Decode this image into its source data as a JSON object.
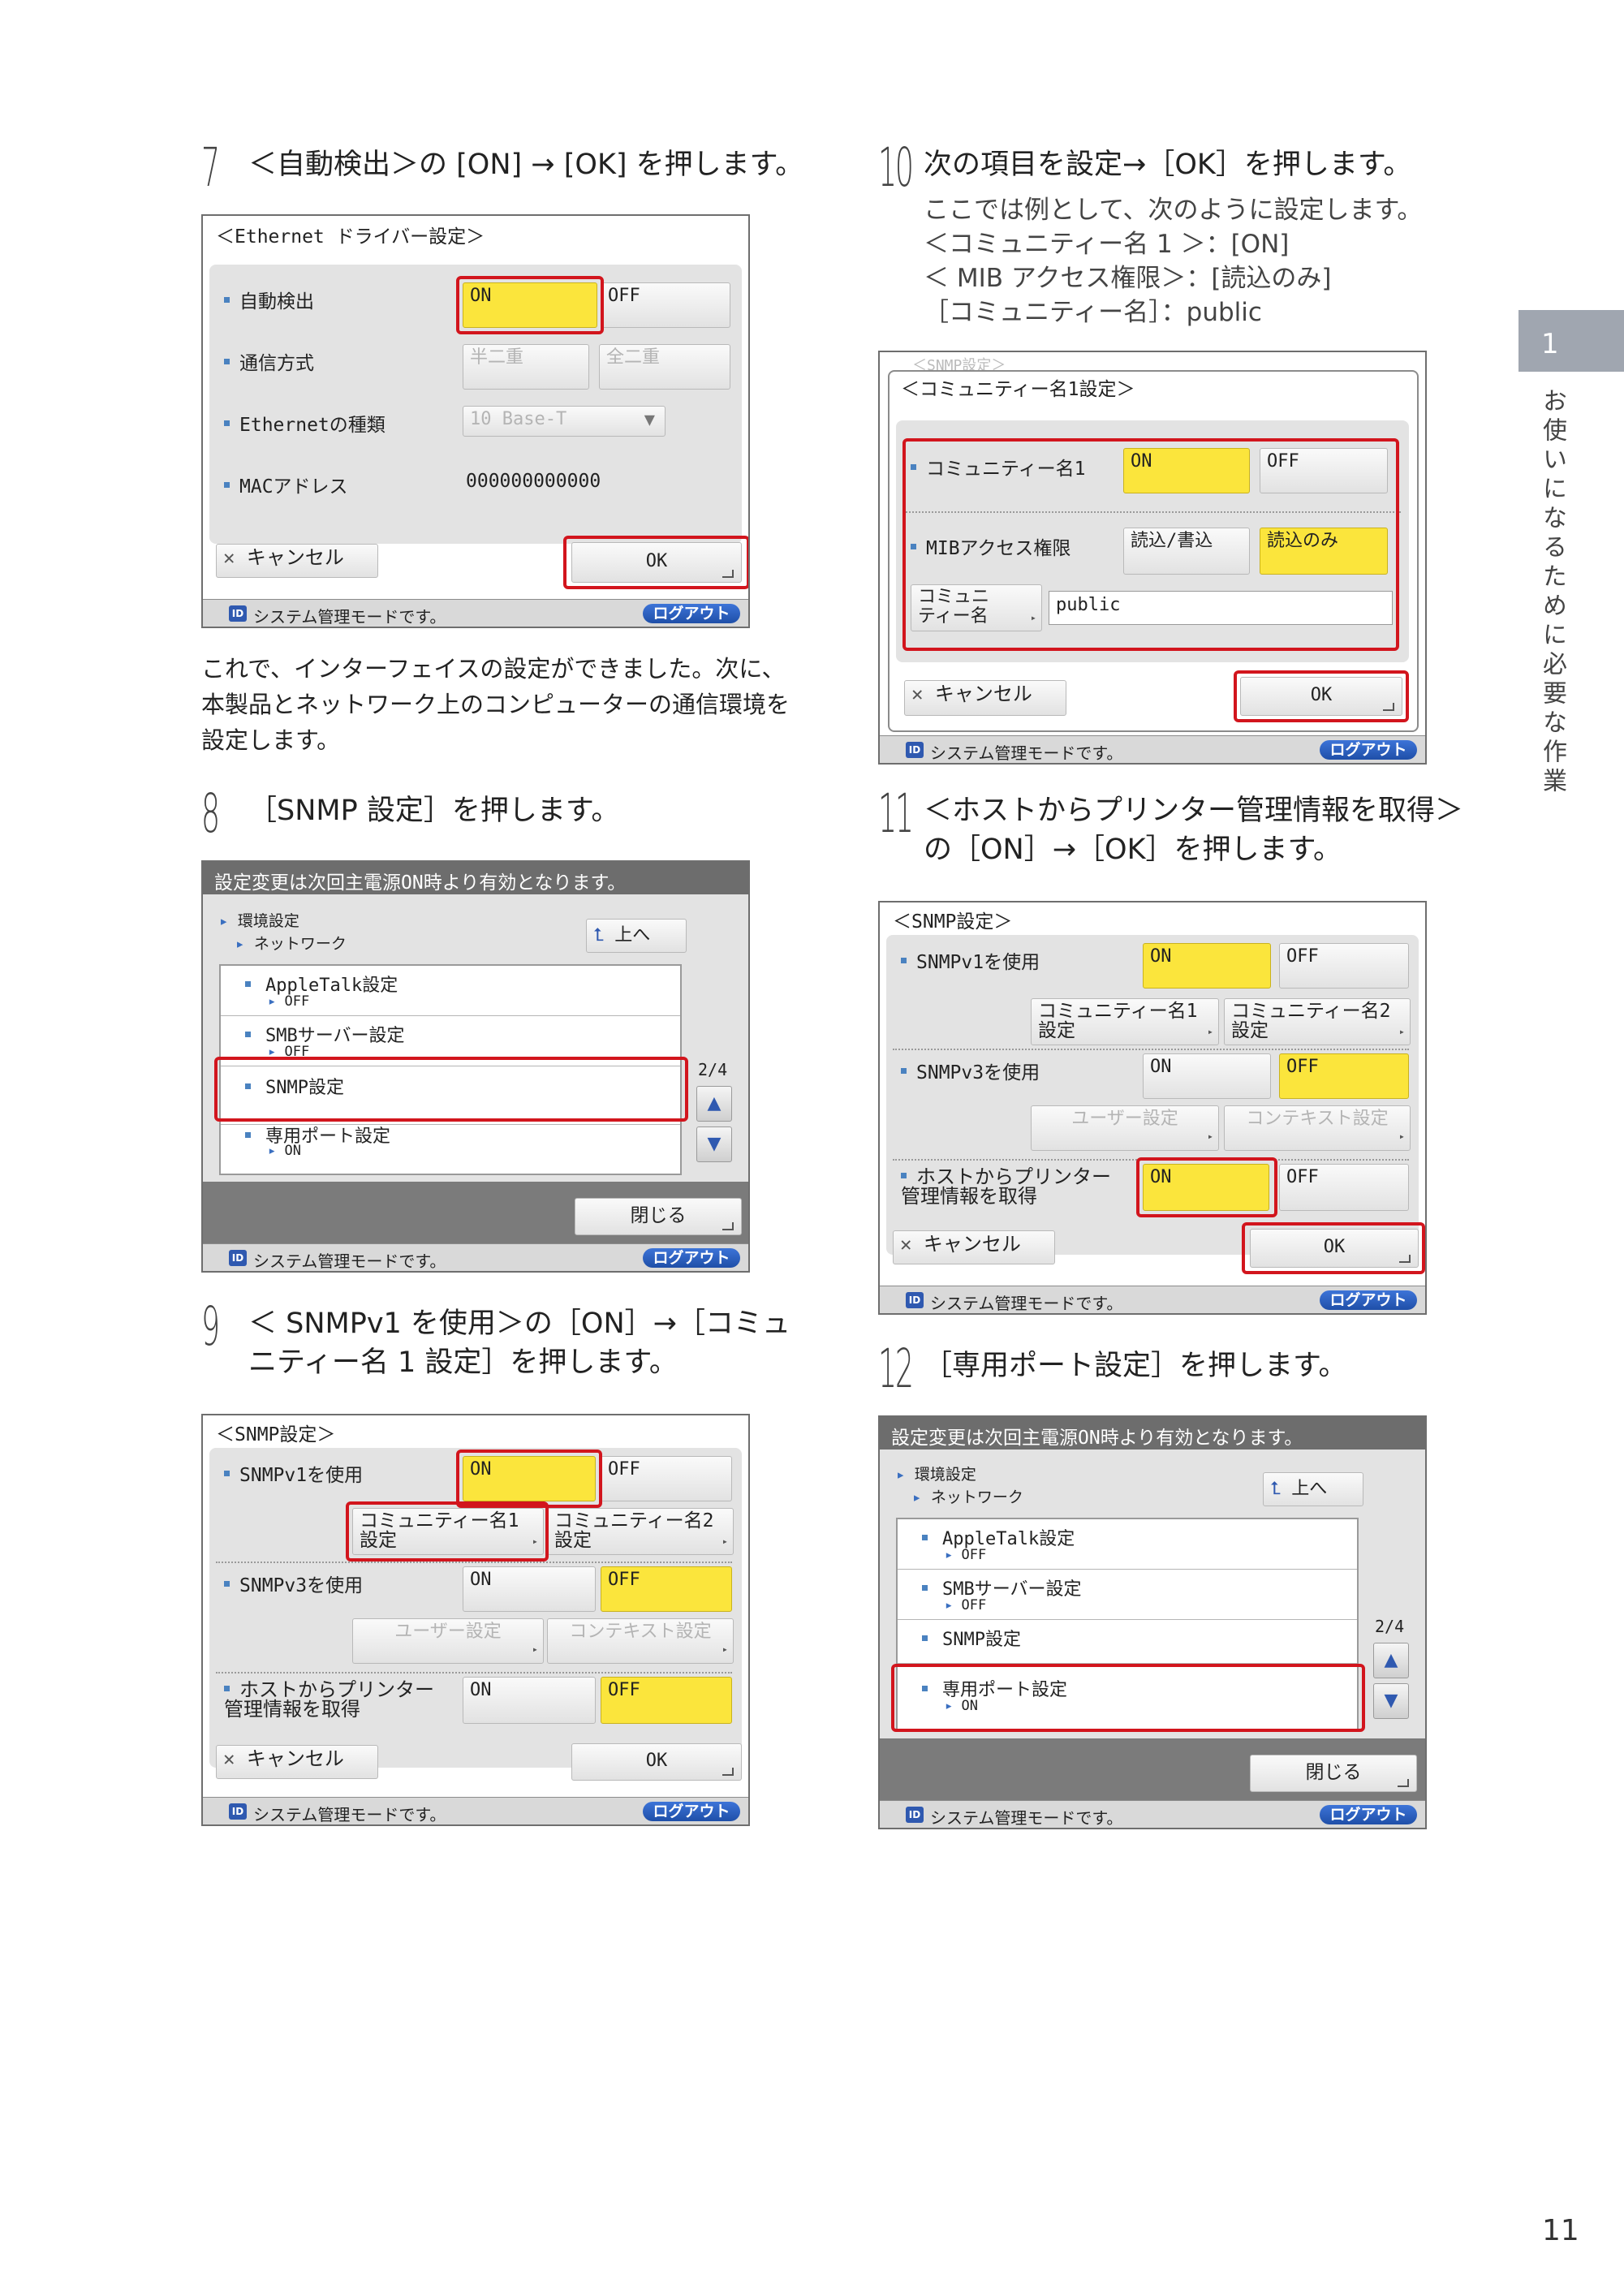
{
  "tab": {
    "number": "1",
    "side_title": "お使いになるために必要な作業"
  },
  "page_number": "11",
  "step7": {
    "num": "7",
    "title": "＜自動検出＞の [ON] → [OK] を押します。",
    "screen": {
      "heading": "＜Ethernet ドライバー設定＞",
      "rows": [
        {
          "label": "自動検出",
          "opt1": "ON",
          "opt2": "OFF"
        },
        {
          "label": "通信方式",
          "opt1": "半二重",
          "opt2": "全二重"
        },
        {
          "label": "Ethernetの種類",
          "select": "10 Base-T"
        },
        {
          "label": "MACアドレス",
          "value": "000000000000"
        }
      ],
      "cancel": "キャンセル",
      "ok": "OK",
      "status": "システム管理モードです。",
      "logout": "ログアウト",
      "id_icon": "ID"
    },
    "after_text": "これで、インターフェイスの設定ができました。次に、本製品とネットワーク上のコンピューターの通信環境を設定します。"
  },
  "step8": {
    "num": "8",
    "title": "［SNMP 設定］を押します。",
    "screen": {
      "bar": "設定変更は次回主電源ON時より有効となります。",
      "crumb1": "環境設定",
      "crumb2": "ネットワーク",
      "up": "上へ",
      "items": [
        {
          "label": "AppleTalk設定",
          "sub": "OFF"
        },
        {
          "label": "SMBサーバー設定",
          "sub": "OFF"
        },
        {
          "label": "SNMP設定",
          "sub": ""
        },
        {
          "label": "専用ポート設定",
          "sub": "ON"
        }
      ],
      "page": "2/4",
      "close": "閉じる",
      "status": "システム管理モードです。",
      "logout": "ログアウト"
    }
  },
  "step9": {
    "num": "9",
    "title_l1": "＜ SNMPv1 を使用＞の［ON］→［コミュ",
    "title_l2": "ニティー名 1 設定］を押します。",
    "screen": {
      "heading": "＜SNMP設定＞",
      "v1": "SNMPv1を使用",
      "on": "ON",
      "off": "OFF",
      "comm1": "コミュニティー名1\n設定",
      "comm2": "コミュニティー名2\n設定",
      "v3": "SNMPv3を使用",
      "user": "ユーザー設定",
      "context": "コンテキスト設定",
      "host": "ホストからプリンター\n管理情報を取得",
      "cancel": "キャンセル",
      "ok": "OK",
      "status": "システム管理モードです。",
      "logout": "ログアウト"
    }
  },
  "step10": {
    "num": "10",
    "title": "次の項目を設定→［OK］を押します。",
    "desc": [
      "ここでは例として、次のように設定します。",
      "＜コミュニティー名 1 ＞：[ON]",
      "＜ MIB アクセス権限＞：[読込のみ]",
      "［コミュニティー名］：public"
    ],
    "screen": {
      "behind": "＜SNMP設定＞",
      "heading": "＜コミュニティー名1設定＞",
      "comm": "コミュニティー名1",
      "on": "ON",
      "off": "OFF",
      "mib": "MIBアクセス権限",
      "rw": "読込/書込",
      "ro": "読込のみ",
      "name_btn": "コミュニ\nティー名",
      "name_val": "public",
      "cancel": "キャンセル",
      "ok": "OK",
      "status": "システム管理モードです。",
      "logout": "ログアウト"
    }
  },
  "step11": {
    "num": "11",
    "title_l1": "＜ホストからプリンター管理情報を取得＞",
    "title_l2": "の［ON］→［OK］を押します。",
    "screen": {
      "heading": "＜SNMP設定＞",
      "v1": "SNMPv1を使用",
      "on": "ON",
      "off": "OFF",
      "comm1": "コミュニティー名1\n設定",
      "comm2": "コミュニティー名2\n設定",
      "v3": "SNMPv3を使用",
      "user": "ユーザー設定",
      "context": "コンテキスト設定",
      "host": "ホストからプリンター\n管理情報を取得",
      "cancel": "キャンセル",
      "ok": "OK",
      "status": "システム管理モードです。",
      "logout": "ログアウト"
    }
  },
  "step12": {
    "num": "12",
    "title": "［専用ポート設定］を押します。",
    "screen": {
      "bar": "設定変更は次回主電源ON時より有効となります。",
      "crumb1": "環境設定",
      "crumb2": "ネットワーク",
      "up": "上へ",
      "items": [
        {
          "label": "AppleTalk設定",
          "sub": "OFF"
        },
        {
          "label": "SMBサーバー設定",
          "sub": "OFF"
        },
        {
          "label": "SNMP設定",
          "sub": ""
        },
        {
          "label": "専用ポート設定",
          "sub": "ON"
        }
      ],
      "page": "2/4",
      "close": "閉じる",
      "status": "システム管理モードです。",
      "logout": "ログアウト"
    }
  }
}
